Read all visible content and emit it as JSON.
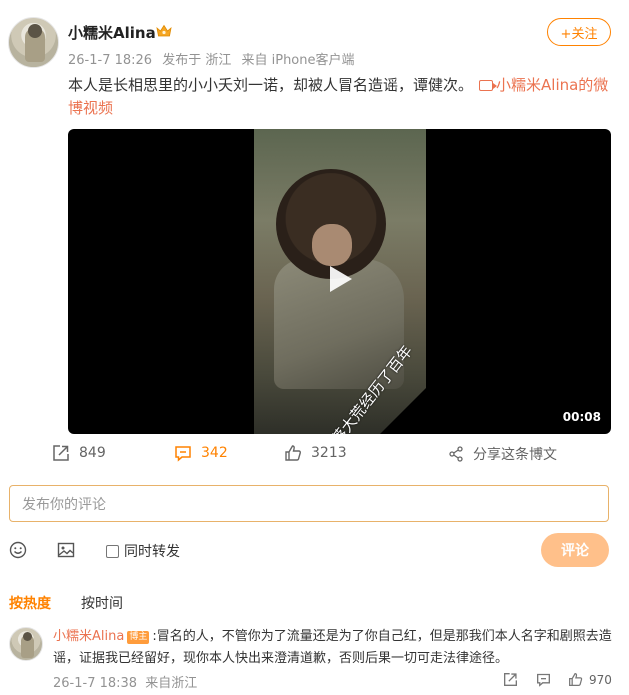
{
  "post": {
    "username": "小糯米Alina",
    "date": "26-1-7 18:26",
    "location": "发布于 浙江",
    "source": "来自 iPhone客户端",
    "follow_label": "+关注",
    "text": "本人是长相思里的小小夭刘一诺，却被人冒名造谣，谭健次。",
    "video_link": "小糯米Alina的微博视频"
  },
  "video": {
    "caption": "他流落大荒经历了百年",
    "duration": "00:08"
  },
  "actions": {
    "repost_count": "849",
    "comment_count": "342",
    "like_count": "3213",
    "share_label": "分享这条博文"
  },
  "compose": {
    "placeholder": "发布你的评论",
    "repost_label": "同时转发",
    "submit_label": "评论"
  },
  "tabs": {
    "hot": "按热度",
    "time": "按时间"
  },
  "comment": {
    "username": "小糯米Alina",
    "badge": "博主",
    "text": ":冒名的人，不管你为了流量还是为了你自己红，但是那我们本人名字和剧照去造谣，证据我已经留好，现你本人快出来澄清道歉，否则后果一切可走法律途径。",
    "date": "26-1-7 18:38",
    "source": "来自浙江",
    "like_count": "970"
  },
  "colors": {
    "accent": "#ff8200",
    "link": "#eb7350",
    "submit_disabled": "#ffc08a"
  }
}
